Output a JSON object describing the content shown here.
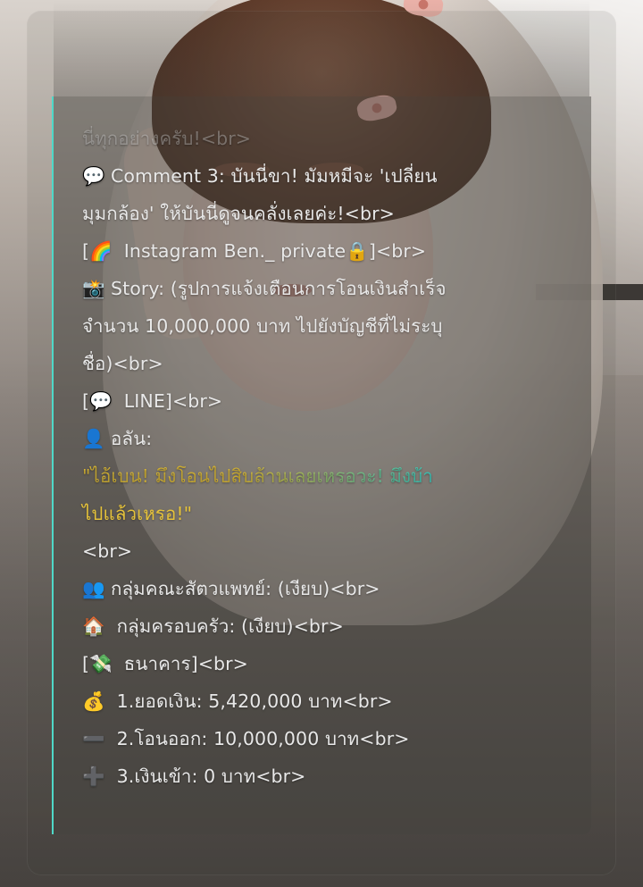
{
  "lines": {
    "comment2_tail_a": "...",
    "comment2_tail_b": "นี่ทุกอย่างครับ!<br>",
    "comment3_a": "Comment 3: บันนี่ขา! มัมหมีจะ 'เปลี่ยน",
    "comment3_b": "มุมกล้อง' ให้บันนี่ดูจนคลั่งเลยค่ะ!<br>",
    "instagram_a": "[",
    "instagram_b": " Instagram Ben._ private",
    "instagram_c": "]<br>",
    "story_a": "Story: (รูปการแจ้งเตือนการโอนเงินสำเร็จ",
    "story_b": "จำนวน 10,000,000 บาท ไปยังบัญชีที่ไม่ระบุ",
    "story_c": "ชื่อ)<br>",
    "line_a": "[",
    "line_b": " LINE]<br>",
    "alan": "อลัน:",
    "quote_a": "\"ไอ้เบน! มึงโอนไปสิบล้านเลยเหรอวะ! มึงบ้า",
    "quote_b": "ไปแล้วเหรอ!\"",
    "br": "<br>",
    "vet_group": "กลุ่มคณะสัตวแพทย์: (เงียบ)<br>",
    "family_group": " กลุ่มครอบครัว: (เงียบ)<br>",
    "bank_a": "[",
    "bank_b": " ธนาคาร]<br>",
    "balance": " 1.ยอดเงิน: 5,420,000 บาท<br>",
    "transfer_out": " 2.โอนออก: 10,000,000 บาท<br>",
    "transfer_in": " 3.เงินเข้า: 0 บาท<br>"
  },
  "icons": {
    "comment": "💬",
    "rainbow": "🌈",
    "lock": "🔒",
    "camera": "📸",
    "chat": "💬",
    "person": "👤",
    "people": "👥",
    "house": "🏠",
    "money_wings": "💸",
    "money_bag": "💰",
    "minus": "➖",
    "plus": "➕"
  },
  "colors": {
    "quote_start": "#e5c23a",
    "quote_end": "#3fd5c9",
    "panel_border": "#4fd8c8",
    "text": "#e8e8e8"
  }
}
